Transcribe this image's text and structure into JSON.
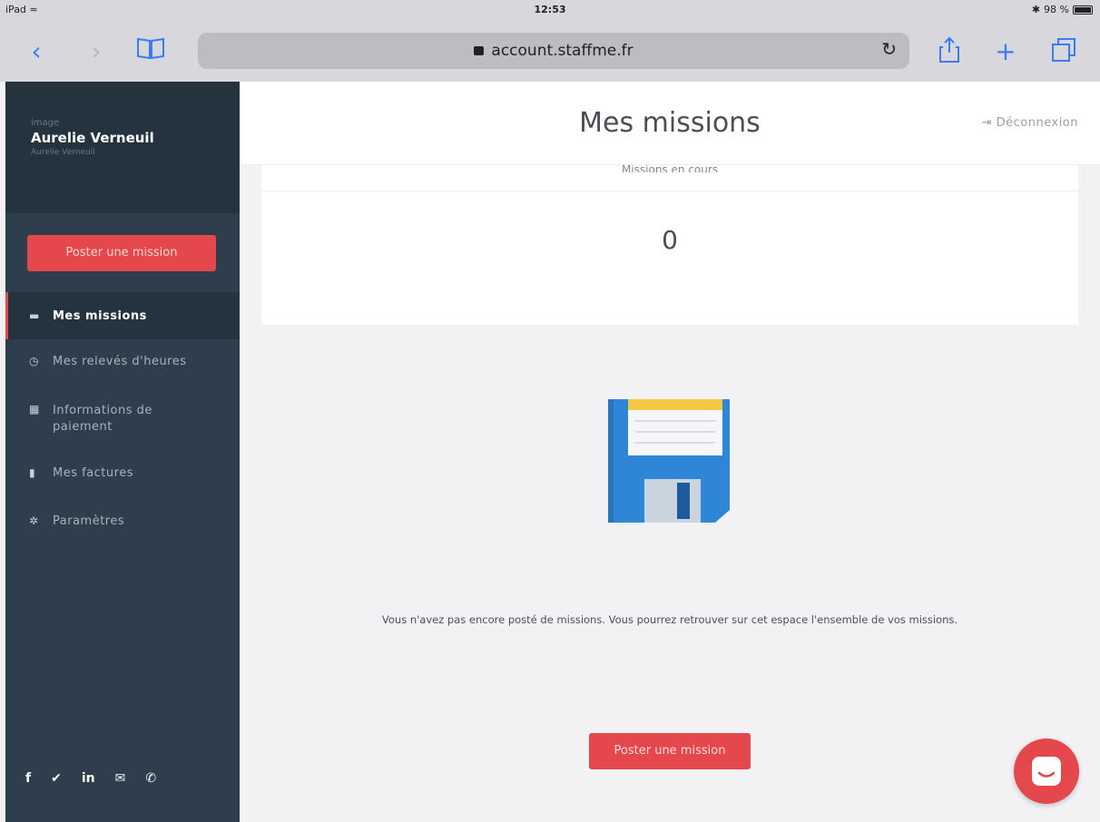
{
  "status_bar": {
    "device": "iPad",
    "time": "12:53",
    "battery": "98 %"
  },
  "browser": {
    "url": "account.staffme.fr"
  },
  "sidebar": {
    "profile_image_text": "image",
    "user_name": "Aurelie Verneuil",
    "user_sub": "Aurelie Verneuil",
    "post_button_label": "Poster une mission",
    "items": [
      {
        "label": "Mes missions",
        "icon": "folder-icon",
        "active": true
      },
      {
        "label": "Mes relevés d'heures",
        "icon": "clock-icon",
        "active": false
      },
      {
        "label": "Informations de paiement",
        "icon": "calendar-icon",
        "active": false
      },
      {
        "label": "Mes factures",
        "icon": "file-icon",
        "active": false
      },
      {
        "label": "Paramètres",
        "icon": "gears-icon",
        "active": false
      }
    ],
    "social": [
      "facebook-icon",
      "twitter-icon",
      "linkedin-icon",
      "mail-icon",
      "phone-icon"
    ]
  },
  "header": {
    "title": "Mes missions",
    "logout_label": "Déconnexion"
  },
  "stats_card": {
    "label": "Missions en cours",
    "count": "0"
  },
  "empty_state": {
    "message": "Vous n'avez pas encore posté de missions. Vous pourrez retrouver sur cet espace l'ensemble de vos missions.",
    "button_label": "Poster une mission"
  },
  "colors": {
    "accent": "#e4474c",
    "sidebar": "#2e3e4c",
    "sidebar_dark": "#25333f"
  }
}
